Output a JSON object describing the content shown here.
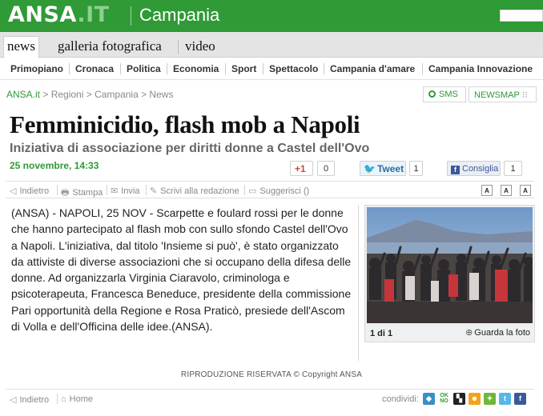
{
  "header": {
    "logo_main": "ANSA",
    "logo_suffix": ".IT",
    "region": "Campania"
  },
  "tabs": [
    {
      "label": "news",
      "active": true
    },
    {
      "label": "galleria fotografica",
      "active": false
    },
    {
      "label": "video",
      "active": false
    }
  ],
  "categories": [
    "Primopiano",
    "Cronaca",
    "Politica",
    "Economia",
    "Sport",
    "Spettacolo",
    "Campania d'amare",
    "Campania Innovazione"
  ],
  "breadcrumb": {
    "home": "ANSA.it",
    "rest": " > Regioni > Campania > News",
    "sms_label": "SMS",
    "newsmap_label": "NEWSMAP"
  },
  "article": {
    "title": "Femminicidio, flash mob a Napoli",
    "subtitle": "Iniziativa di associazione per diritti donne a Castel dell'Ovo",
    "date": "25 novembre, 14:33",
    "body": "(ANSA) - NAPOLI, 25 NOV - Scarpette e foulard rossi per le donne che hanno partecipato al flash mob con sullo sfondo Castel dell'Ovo a Napoli. L'iniziativa, dal titolo 'Insieme si può', è stato organizzato da attiviste di diverse associazioni che si occupano della difesa delle donne. Ad organizzarla Virginia Ciaravolo, criminologa e psicoterapeuta, Francesca Beneduce, presidente della commissione Pari opportunità della Regione e Rosa Praticò, presiede dell'Ascom di Volla e dell'Officina delle idee.(ANSA)."
  },
  "social": {
    "gplus_label": "+1",
    "gplus_count": "0",
    "tweet_label": "Tweet",
    "tweet_count": "1",
    "fb_label": "Consiglia",
    "fb_count": "1"
  },
  "toolbar": {
    "back": "Indietro",
    "print": "Stampa",
    "send": "Invia",
    "write": "Scrivi alla redazione",
    "suggest": "Suggerisci ()",
    "font_label": "A"
  },
  "photo": {
    "counter": "1 di 1",
    "view_label": "Guarda la foto"
  },
  "footer": {
    "copyright": "RIPRODUZIONE RISERVATA © Copyright ANSA",
    "back": "Indietro",
    "home": "Home",
    "share_label": "condividi:"
  },
  "colors": {
    "brand_green": "#2f9a36",
    "date_green": "#2f9a36",
    "facebook_blue": "#3b5998",
    "twitter_blue": "#2a9bd6",
    "gplus_red": "#d14836"
  }
}
